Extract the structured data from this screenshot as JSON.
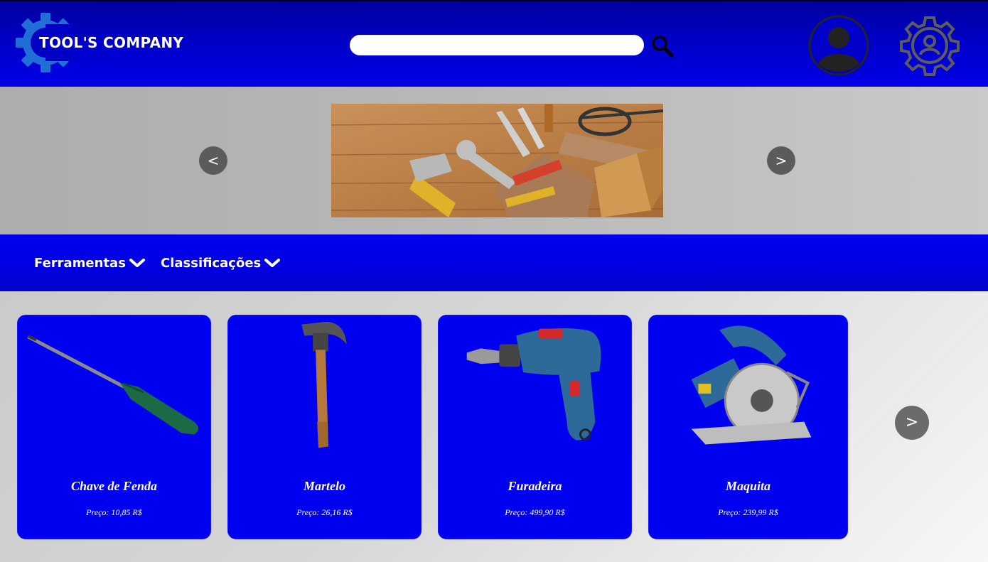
{
  "header": {
    "logo_text": "TOOL'S COMPANY",
    "search": {
      "value": "",
      "placeholder": ""
    },
    "icons": {
      "search": "search-icon",
      "user": "user-icon",
      "settings": "user-gear-icon"
    }
  },
  "banner": {
    "prev_label": "<",
    "next_label": ">",
    "image": "tools-on-wood-photo"
  },
  "nav": {
    "items": [
      {
        "label": "Ferramentas",
        "icon": "chevron-down-icon"
      },
      {
        "label": "Classificações",
        "icon": "chevron-down-icon"
      }
    ]
  },
  "products": {
    "items": [
      {
        "name": "Chave de Fenda",
        "price": "Preço: 10,85 R$",
        "image": "screwdriver-image"
      },
      {
        "name": "Martelo",
        "price": "Preço: 26,16 R$",
        "image": "hammer-image"
      },
      {
        "name": "Furadeira",
        "price": "Preço: 499,90 R$",
        "image": "drill-image"
      },
      {
        "name": "Maquita",
        "price": "Preço: 239,99 R$",
        "image": "circular-saw-image"
      }
    ],
    "next_label": ">"
  },
  "colors": {
    "header_blue": "#0000cc",
    "nav_blue": "#0000ee",
    "card_blue": "#0000f0",
    "logo_gear": "#1f6fd6",
    "arrow_gray": "#5b5b5b"
  }
}
